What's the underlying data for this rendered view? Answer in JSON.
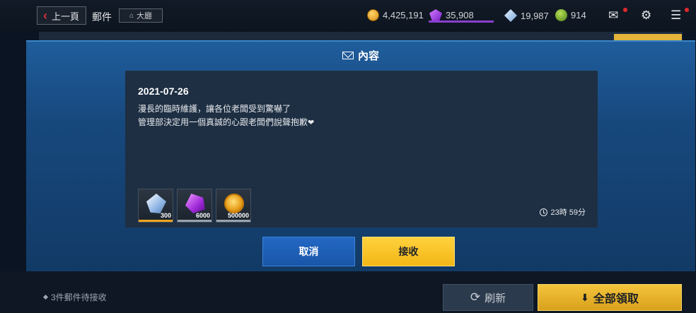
{
  "topbar": {
    "back_label": "上一頁",
    "title": "郵件",
    "lobby_label": "大廳",
    "resources": [
      {
        "icon": "gold-coin-icon",
        "value": "4,425,191"
      },
      {
        "icon": "purple-gem-icon",
        "value": "35,908"
      },
      {
        "icon": "crystal-icon",
        "value": "19,987"
      },
      {
        "icon": "green-energy-icon",
        "value": "914"
      }
    ]
  },
  "modal": {
    "title": "內容",
    "date": "2021-07-26",
    "body_line1": "漫長的臨時維護，讓各位老闆受到驚嚇了",
    "body_line2": "管理部決定用一個真誠的心跟老闆們說聲抱歉",
    "heart": "❤",
    "rewards": [
      {
        "icon": "crystal-icon",
        "qty": "300"
      },
      {
        "icon": "purple-gem-icon",
        "qty": "6000"
      },
      {
        "icon": "gold-coin-icon",
        "qty": "500000"
      }
    ],
    "timer": "23時 59分",
    "cancel_label": "取消",
    "receive_label": "接收"
  },
  "bottombar": {
    "pending_text": "3件郵件待接收",
    "refresh_label": "刷新",
    "claim_all_label": "全部領取"
  },
  "colors": {
    "modal_blue": "#1a4f87",
    "receive_yellow": "#f7c427",
    "cancel_blue": "#1f60b8",
    "notification_red": "#e02c2c"
  }
}
